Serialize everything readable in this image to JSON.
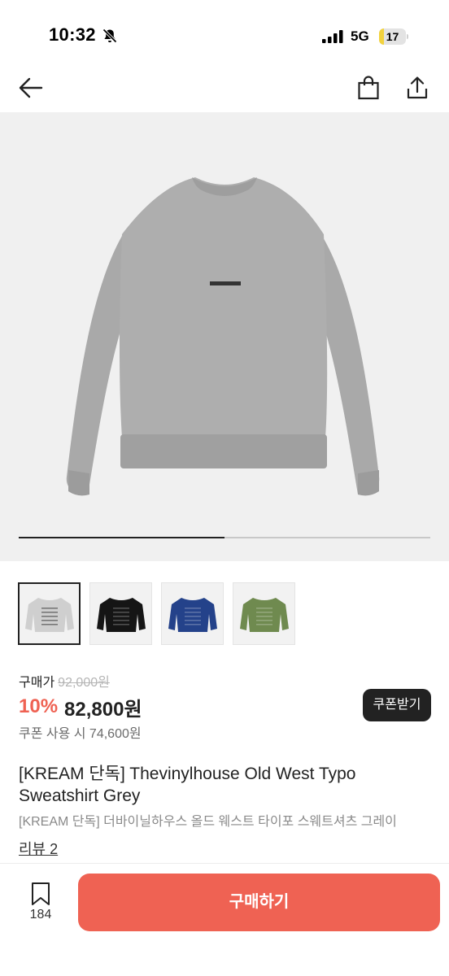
{
  "status_bar": {
    "time": "10:32",
    "network": "5G",
    "battery_level": "17",
    "battery_fraction": 0.17,
    "icons": [
      "bell-off-icon",
      "signal-icon",
      "battery-icon"
    ]
  },
  "nav": {
    "icons": [
      "back-arrow-icon",
      "shopping-bag-icon",
      "share-icon"
    ]
  },
  "gallery": {
    "progress_fraction": 0.5,
    "thumbnails": [
      {
        "name": "grey",
        "color": "#cfcfcf",
        "selected": true
      },
      {
        "name": "black",
        "color": "#151515",
        "selected": false
      },
      {
        "name": "navy",
        "color": "#24428a",
        "selected": false
      },
      {
        "name": "olive",
        "color": "#6f8a4f",
        "selected": false
      }
    ]
  },
  "price": {
    "buy_label": "구매가",
    "original_price": "92,000원",
    "discount": "10%",
    "sale_price": "82,800원",
    "coupon_price": "쿠폰 사용 시 74,600원",
    "coupon_button": "쿠폰받기"
  },
  "product": {
    "title": "[KREAM 단독] Thevinylhouse Old West Typo Sweatshirt Grey",
    "subtitle": "[KREAM 단독] 더바이닐하우스 올드 웨스트 타이포 스웨트셔츠 그레이",
    "review_link": "리뷰 2"
  },
  "bottom_bar": {
    "wish_count": "184",
    "buy_button": "구매하기"
  },
  "colors": {
    "accent": "#ef6253",
    "dark": "#222222",
    "hero_bg": "#f0f0f0"
  }
}
